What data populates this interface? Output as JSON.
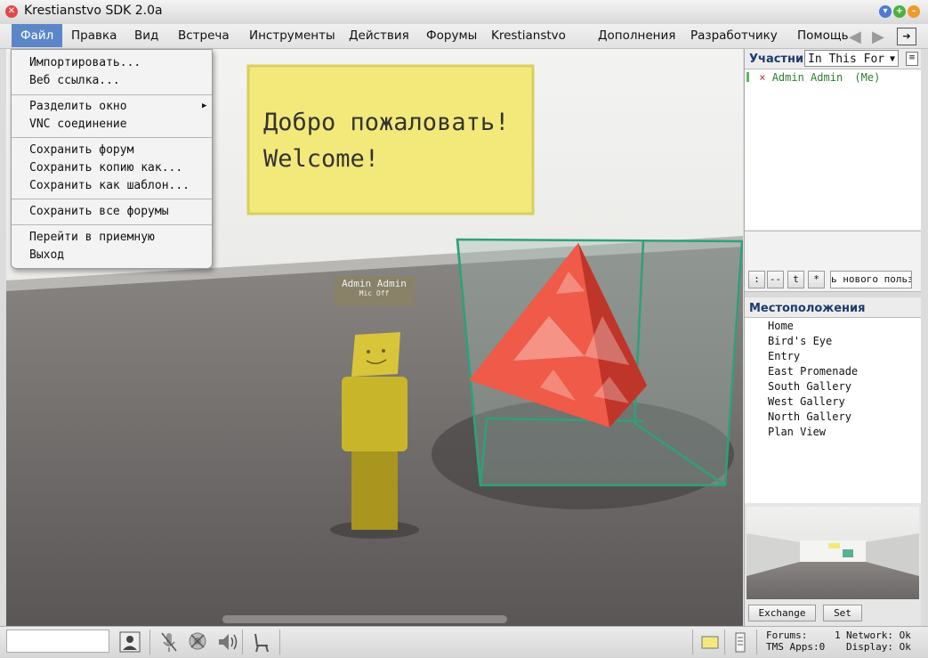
{
  "window": {
    "title": "Krestianstvo SDK 2.0a"
  },
  "menubar": {
    "items": [
      "Файл",
      "Правка",
      "Вид",
      "Встреча",
      "Инструменты",
      "Действия",
      "Форумы",
      "Krestianstvo",
      "Дополнения",
      "Разработчику",
      "Помощь"
    ],
    "back_icon": "triangle-left-icon",
    "forward_icon": "triangle-right-icon",
    "exit_icon": "exit-arrow-icon"
  },
  "file_menu": {
    "groups": [
      [
        "Импортировать...",
        "Веб ссылка..."
      ],
      [
        "Разделить окно",
        "VNC соединение"
      ],
      [
        "Сохранить форум",
        "Сохранить копию как...",
        "Сохранить как шаблон..."
      ],
      [
        "Сохранить все форумы"
      ],
      [
        "Перейти в приемную",
        "Выход"
      ]
    ],
    "submenu_arrow": "▶"
  },
  "scene": {
    "sign_line1": "Добро пожаловать!",
    "sign_line2": "Welcome!",
    "avatar_name": "Admin Admin",
    "avatar_status": "Mic Off"
  },
  "participants": {
    "header": "Участники",
    "scope_select": "In This For",
    "users": [
      {
        "mark": "×",
        "name": "Admin Admin",
        "tag": "(Me)"
      }
    ],
    "toolbar": [
      ":",
      "--",
      "t",
      "*"
    ],
    "new_user_input": "ь нового пользо"
  },
  "locations": {
    "header": "Местоположения",
    "items": [
      "Home",
      "Bird's Eye",
      "Entry",
      "East Promenade",
      "South Gallery",
      "West Gallery",
      "North Gallery",
      "Plan View"
    ]
  },
  "preview": {
    "exchange_label": "Exchange",
    "set_label": "Set"
  },
  "status": {
    "search_value": "",
    "forums_label": "Forums:",
    "forums_value": "1",
    "tms_label": "TMS Apps:",
    "tms_value": "0",
    "network_label": "Network:",
    "network_value": "Ok",
    "display_label": "Display:",
    "display_value": "Ok"
  },
  "colors": {
    "accent": "#5b87c9",
    "sign": "#f3e97a",
    "pyramid": "#e8473a",
    "cube": "#2fa07a",
    "avatar": "#c9b52a",
    "header_text": "#1c3a6e"
  }
}
